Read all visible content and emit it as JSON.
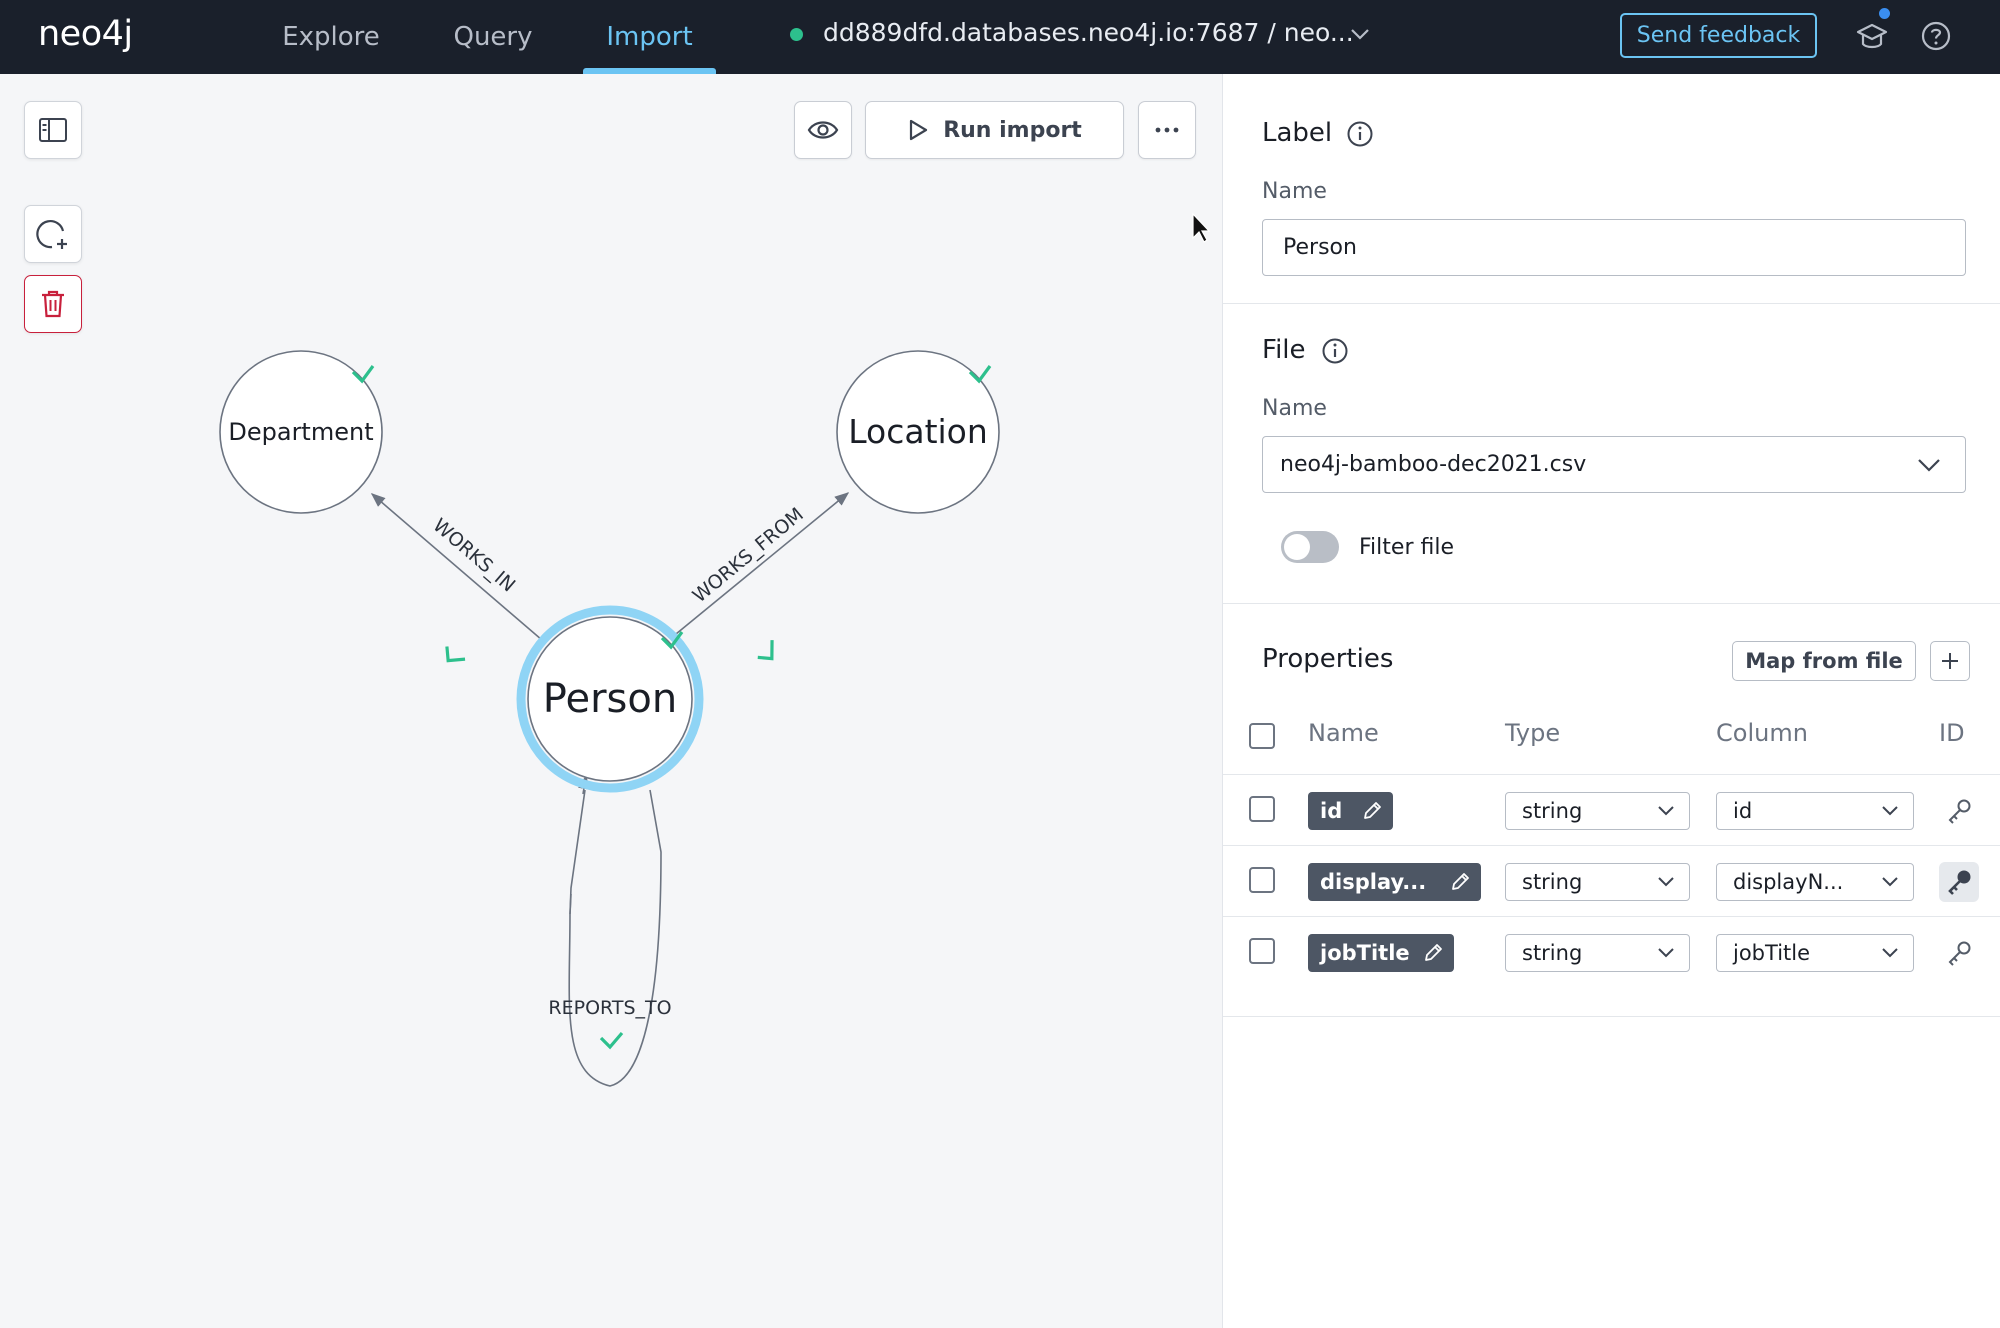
{
  "app": {
    "logo_text": "neo4j"
  },
  "nav": {
    "explore": "Explore",
    "query": "Query",
    "import": "Import",
    "active": "Import"
  },
  "connection": {
    "status": "connected",
    "status_color": "#2dc08d",
    "text": "dd889dfd.databases.neo4j.io:7687 / neo..."
  },
  "header_actions": {
    "feedback": "Send feedback",
    "learn_icon": "graduation-cap-icon",
    "help_icon": "help-circle-icon"
  },
  "toolbar": {
    "preview_icon": "eye-icon",
    "run_import": "Run import",
    "more_icon": "more-horizontal-icon"
  },
  "left_tools": {
    "toggle_sidebar_icon": "sidebar-icon",
    "add_node_icon": "add-node-icon",
    "delete_icon": "trash-icon"
  },
  "graph": {
    "nodes": [
      {
        "id": "department",
        "label": "Department",
        "mapped": true,
        "selected": false
      },
      {
        "id": "location",
        "label": "Location",
        "mapped": true,
        "selected": false
      },
      {
        "id": "person",
        "label": "Person",
        "mapped": true,
        "selected": true
      }
    ],
    "relationships": [
      {
        "type": "WORKS_IN",
        "from": "person",
        "to": "department",
        "mapped": true
      },
      {
        "type": "WORKS_FROM",
        "from": "person",
        "to": "location",
        "mapped": true
      },
      {
        "type": "REPORTS_TO",
        "from": "person",
        "to": "person",
        "mapped": true
      }
    ]
  },
  "panel": {
    "label_section": {
      "title": "Label",
      "name_label": "Name",
      "name_value": "Person"
    },
    "file_section": {
      "title": "File",
      "name_label": "Name",
      "file_value": "neo4j-bamboo-dec2021.csv",
      "filter_label": "Filter file",
      "filter_enabled": false
    },
    "properties_section": {
      "title": "Properties",
      "map_from_file": "Map from file",
      "columns": {
        "name": "Name",
        "type": "Type",
        "column": "Column",
        "id": "ID"
      },
      "rows": [
        {
          "name": "id",
          "type": "string",
          "column": "id",
          "is_id": false
        },
        {
          "name": "display...",
          "type": "string",
          "column": "displayN...",
          "is_id": true
        },
        {
          "name": "jobTitle",
          "type": "string",
          "column": "jobTitle",
          "is_id": false
        }
      ]
    }
  },
  "colors": {
    "accent": "#6bc4f3",
    "mapped_check": "#2dc08d",
    "danger": "#c8203c",
    "topbar": "#1a202b"
  }
}
